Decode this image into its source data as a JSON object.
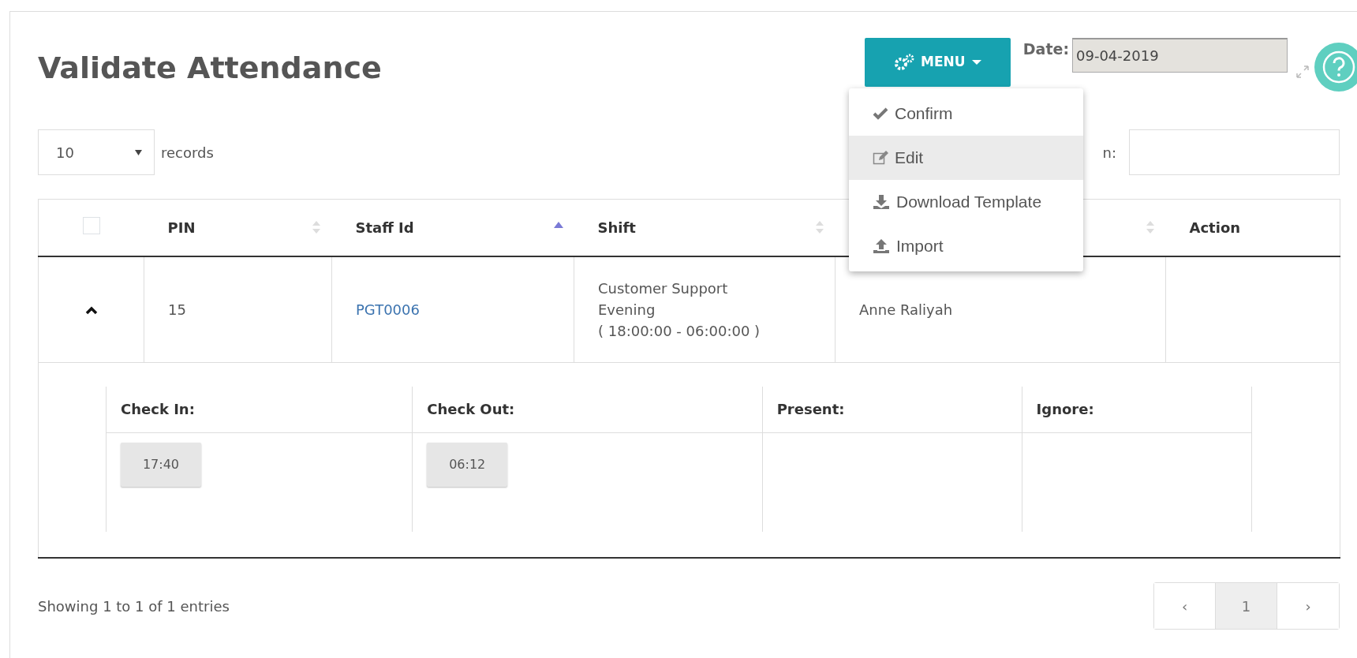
{
  "page": {
    "title": "Validate Attendance"
  },
  "menu": {
    "label": "MENU",
    "expanded": true,
    "items": [
      {
        "label": "Confirm",
        "selected": false
      },
      {
        "label": "Edit",
        "selected": true
      },
      {
        "label": "Download Template",
        "selected": false
      },
      {
        "label": "Import",
        "selected": false
      }
    ]
  },
  "date": {
    "label": "Date:",
    "value": "09-04-2019"
  },
  "length": {
    "value": "10",
    "label": "records"
  },
  "search": {
    "label": "n:"
  },
  "table": {
    "columns": [
      {
        "kind": "checkbox",
        "checked": false,
        "sortable": false,
        "sorted": false
      },
      {
        "kind": "text",
        "label": "PIN",
        "sortable": true,
        "sorted": false
      },
      {
        "kind": "text",
        "label": "Staff Id",
        "sortable": true,
        "sorted": true
      },
      {
        "kind": "text",
        "label": "Shift",
        "sortable": true,
        "sorted": false
      },
      {
        "kind": "text",
        "sortable": true,
        "sorted": false
      },
      {
        "kind": "text",
        "label": "Action",
        "sortable": false,
        "sorted": false
      }
    ],
    "rows": [
      {
        "expanded": true,
        "pin": "15",
        "staff_id": "PGT0006",
        "shift": [
          "Customer Support",
          "Evening",
          "( 18:00:00 - 06:00:00 )"
        ],
        "name": "Anne Raliyah",
        "detail": {
          "columns": [
            "Check In:",
            "Check Out:",
            "Present:",
            "Ignore:"
          ],
          "check_in": "17:40",
          "check_out": "06:12"
        }
      }
    ]
  },
  "footer": {
    "info": "Showing 1 to 1 of 1 entries",
    "prev": "‹",
    "next": "›",
    "pages": [
      {
        "label": "1",
        "selected": true
      }
    ]
  }
}
